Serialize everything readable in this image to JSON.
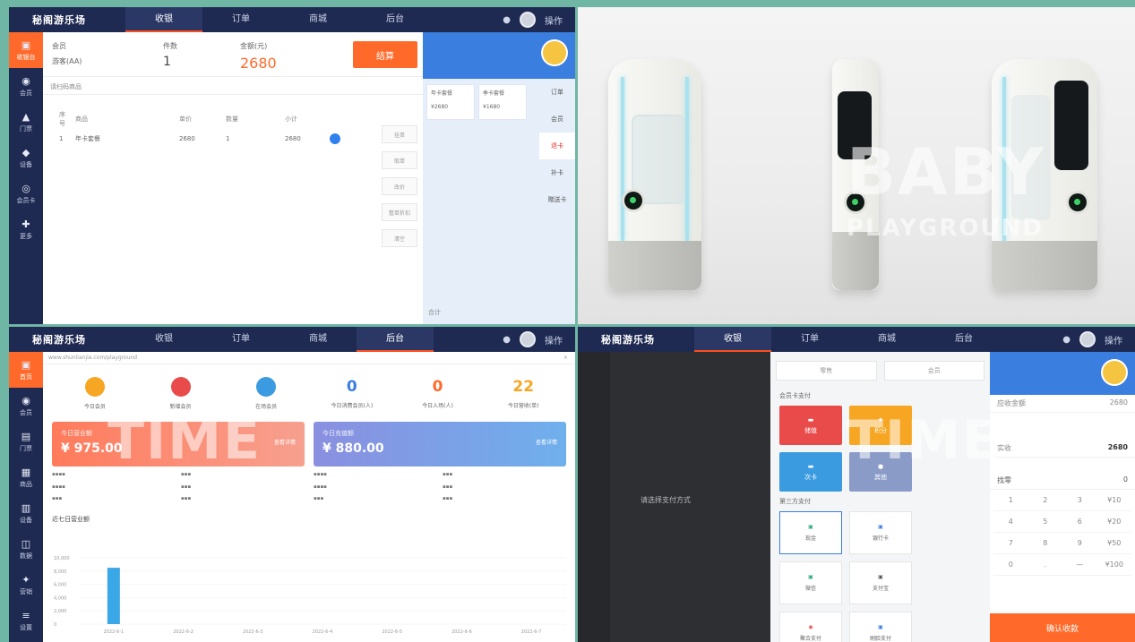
{
  "app": {
    "brand": "秘阁游乐场",
    "user": "操作"
  },
  "nav_tabs": [
    {
      "label": "收银",
      "icon": "cart-icon"
    },
    {
      "label": "订单",
      "icon": "order-icon"
    },
    {
      "label": "商城",
      "icon": "shop-icon"
    },
    {
      "label": "后台",
      "icon": "monitor-icon"
    }
  ],
  "q1": {
    "sidebar": [
      "收银台",
      "会员",
      "门票",
      "设备",
      "会员卡",
      "更多"
    ],
    "head": {
      "member_label": "会员",
      "member_name": "游客(AA)",
      "count_label": "件数",
      "count": "1",
      "total_label": "金额(元)",
      "total": "2680",
      "settle": "结算"
    },
    "scan_placeholder": "请扫码商品",
    "table_headers": [
      "序号",
      "商品",
      "单价",
      "数量",
      "小计"
    ],
    "rows": [
      {
        "no": "1",
        "name": "年卡套餐",
        "price": "2680",
        "qty": "1",
        "subtotal": "2680"
      }
    ],
    "side_buttons": [
      "挂单",
      "取单",
      "改价",
      "整单折扣",
      "清空"
    ],
    "right_tabs": [
      "订单",
      "会员",
      "退卡",
      "补卡",
      "赠送卡"
    ],
    "cards": [
      {
        "title": "年卡套餐",
        "price": "¥2680"
      },
      {
        "title": "季卡套餐",
        "price": "¥1680"
      }
    ],
    "footer": "合计"
  },
  "q2": {
    "watermark_top": "BABY",
    "watermark_bottom": "PLAYGROUND"
  },
  "q3": {
    "sidebar": [
      "首页",
      "会员",
      "门票",
      "商品",
      "设备",
      "数据",
      "营销",
      "设置"
    ],
    "url": "www.shunlianjia.com/playground",
    "stats": [
      {
        "label": "今日会员",
        "value": "",
        "color": "#f6a623"
      },
      {
        "label": "新增会员",
        "value": "",
        "color": "#e94b4b"
      },
      {
        "label": "在场会员",
        "value": "",
        "color": "#3a9be0"
      },
      {
        "label": "今日消费会员(人)",
        "value": "0",
        "color": "#3a7ee0"
      },
      {
        "label": "今日入场(人)",
        "value": "0",
        "color": "#ff6a2b"
      },
      {
        "label": "今日营收(单)",
        "value": "22",
        "color": "#f6a623"
      }
    ],
    "card_left": {
      "label": "今日营业额",
      "amount": "¥ 975.00",
      "right": "查看详情"
    },
    "card_right": {
      "label": "今日充值额",
      "amount": "¥ 880.00",
      "right": "查看详情"
    },
    "chart_title": "近七日营业额",
    "watermark": "TIME"
  },
  "chart_data": {
    "type": "bar",
    "title": "近七日营业额",
    "categories": [
      "2022-6-1",
      "2022-6-2",
      "2022-6-3",
      "2022-6-4",
      "2022-6-5",
      "2022-6-6",
      "2022-6-7"
    ],
    "values": [
      8500,
      0,
      0,
      0,
      0,
      0,
      0
    ],
    "y_ticks": [
      "10,000",
      "8,000",
      "6,000",
      "4,000",
      "2,000",
      "0"
    ],
    "ylim": [
      0,
      10000
    ]
  },
  "q4": {
    "left_msg": "请选择支付方式",
    "seg": [
      "零售",
      "会员"
    ],
    "sec1": "会员卡支付",
    "tiles": [
      {
        "label": "储值",
        "color": "#e94b4b"
      },
      {
        "label": "积分",
        "color": "#f6a623"
      },
      {
        "label": "次卡",
        "color": "#3a9be0"
      },
      {
        "label": "其他",
        "color": "#8a9bc8"
      }
    ],
    "sec2": "第三方支付",
    "methods": [
      "现金",
      "银行卡",
      "微信",
      "支付宝",
      "聚合支付",
      "刷脸支付"
    ],
    "amount_label": "应收金额",
    "amount": "2680",
    "paid_label": "实收",
    "paid": "2680",
    "qty_label": "找零",
    "qty": "0",
    "keys": [
      "1",
      "2",
      "3",
      "¥10",
      "4",
      "5",
      "6",
      "¥20",
      "7",
      "8",
      "9",
      "¥50",
      "0",
      ".",
      "—",
      "¥100"
    ],
    "collect": "确认收款",
    "watermark": "TIME"
  }
}
